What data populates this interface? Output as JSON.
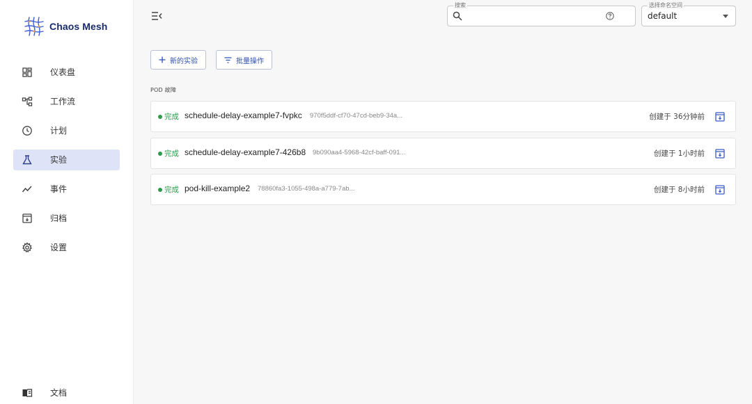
{
  "brand": {
    "title": "Chaos Mesh"
  },
  "sidebar": {
    "items": [
      {
        "label": "仪表盘",
        "icon": "dashboard-icon"
      },
      {
        "label": "工作流",
        "icon": "workflow-icon"
      },
      {
        "label": "计划",
        "icon": "clock-icon"
      },
      {
        "label": "实验",
        "icon": "flask-icon",
        "active": true
      },
      {
        "label": "事件",
        "icon": "events-icon"
      },
      {
        "label": "归档",
        "icon": "archive-icon"
      },
      {
        "label": "设置",
        "icon": "gear-icon"
      }
    ],
    "docs": {
      "label": "文档",
      "icon": "book-icon"
    }
  },
  "header": {
    "search": {
      "legend": "搜索",
      "value": ""
    },
    "namespace": {
      "legend": "选择命名空间",
      "value": "default"
    }
  },
  "toolbar": {
    "new_label": "新的实验",
    "batch_label": "批量操作"
  },
  "section": {
    "label": "POD 故障"
  },
  "experiments": [
    {
      "status": "完成",
      "name": "schedule-delay-example7-fvpkc",
      "uid": "970f5ddf-cf70-47cd-beb9-34a...",
      "created": "创建于 36分钟前"
    },
    {
      "status": "完成",
      "name": "schedule-delay-example7-426b8",
      "uid": "9b090aa4-5968-42cf-baff-091...",
      "created": "创建于 1小时前"
    },
    {
      "status": "完成",
      "name": "pod-kill-example2",
      "uid": "78860fa3-1055-498a-a779-7ab...",
      "created": "创建于 8小时前"
    }
  ],
  "colors": {
    "accent": "#2d4fb0",
    "active_bg": "#dfe3f7",
    "success": "#2e9b4a",
    "brand": "#172b6c"
  }
}
